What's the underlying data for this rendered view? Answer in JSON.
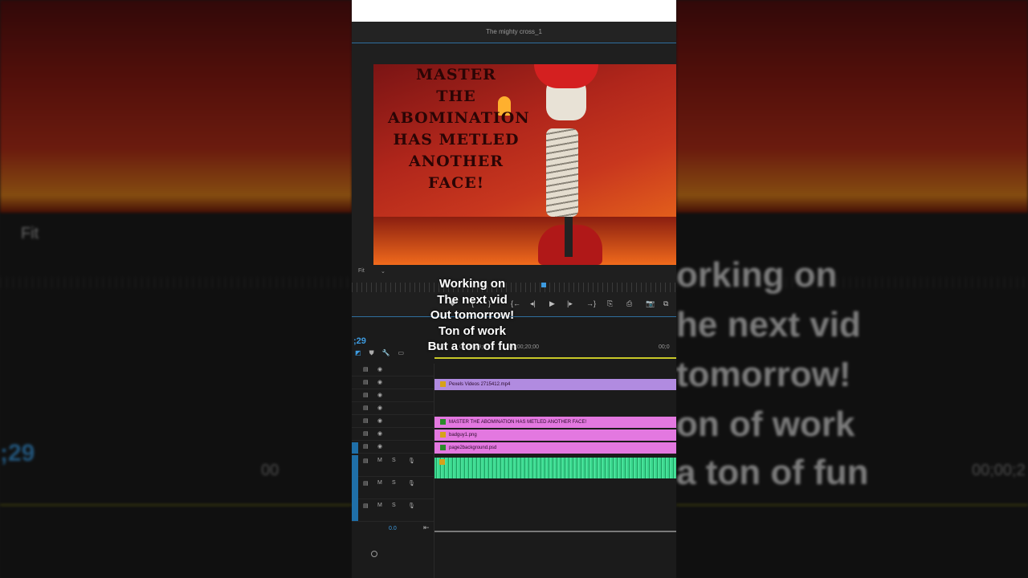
{
  "monitor": {
    "sequence_title": "The mighty cross_1",
    "zoom": "Fit"
  },
  "poster": {
    "lines": [
      "MASTER",
      "THE",
      "ABOMINATION",
      "HAS METLED",
      "ANOTHER",
      "FACE!"
    ]
  },
  "transport": {
    "buttons": [
      "⛊",
      "{",
      "}",
      "{←",
      "◂|",
      "▶",
      "|▸",
      "→}",
      "⎘",
      "⎙",
      "📷",
      "⧉"
    ]
  },
  "timeline": {
    "timecode": ";29",
    "ruler": [
      "00",
      "00;00;19;00",
      "00;00;20;00",
      "00;0"
    ],
    "bottom_value": "0.0",
    "clips": [
      {
        "label": "Pexels Videos 2715412.mp4",
        "color": "#b18be0",
        "badge": "fx"
      },
      {
        "label": "MASTER THE ABOMINATION HAS METLED ANOTHER FACE!",
        "color": "#e378e0",
        "badge": "fx"
      },
      {
        "label": "badguy1.png",
        "color": "#e378e0",
        "badge": "fx"
      },
      {
        "label": "page2background.psd",
        "color": "#e378e0",
        "badge": "fx"
      }
    ],
    "track_buttons": {
      "mute": "M",
      "solo": "S"
    }
  },
  "caption": [
    "Working on",
    "The next vid",
    "Out tomorrow!",
    "Ton of work",
    "But a ton of fun"
  ],
  "background": {
    "left_zoom": "Fit",
    "left_timecode": ";29",
    "right_text": [
      "orking on",
      "he next vid",
      " tomorrow!",
      "on of work",
      "a ton of fun"
    ],
    "right_ruler": "00;00;2",
    "left_ruler": "00"
  },
  "colors": {
    "accent": "#3d9be0",
    "audio": "#37d68c",
    "video_clip": "#e378e0"
  }
}
